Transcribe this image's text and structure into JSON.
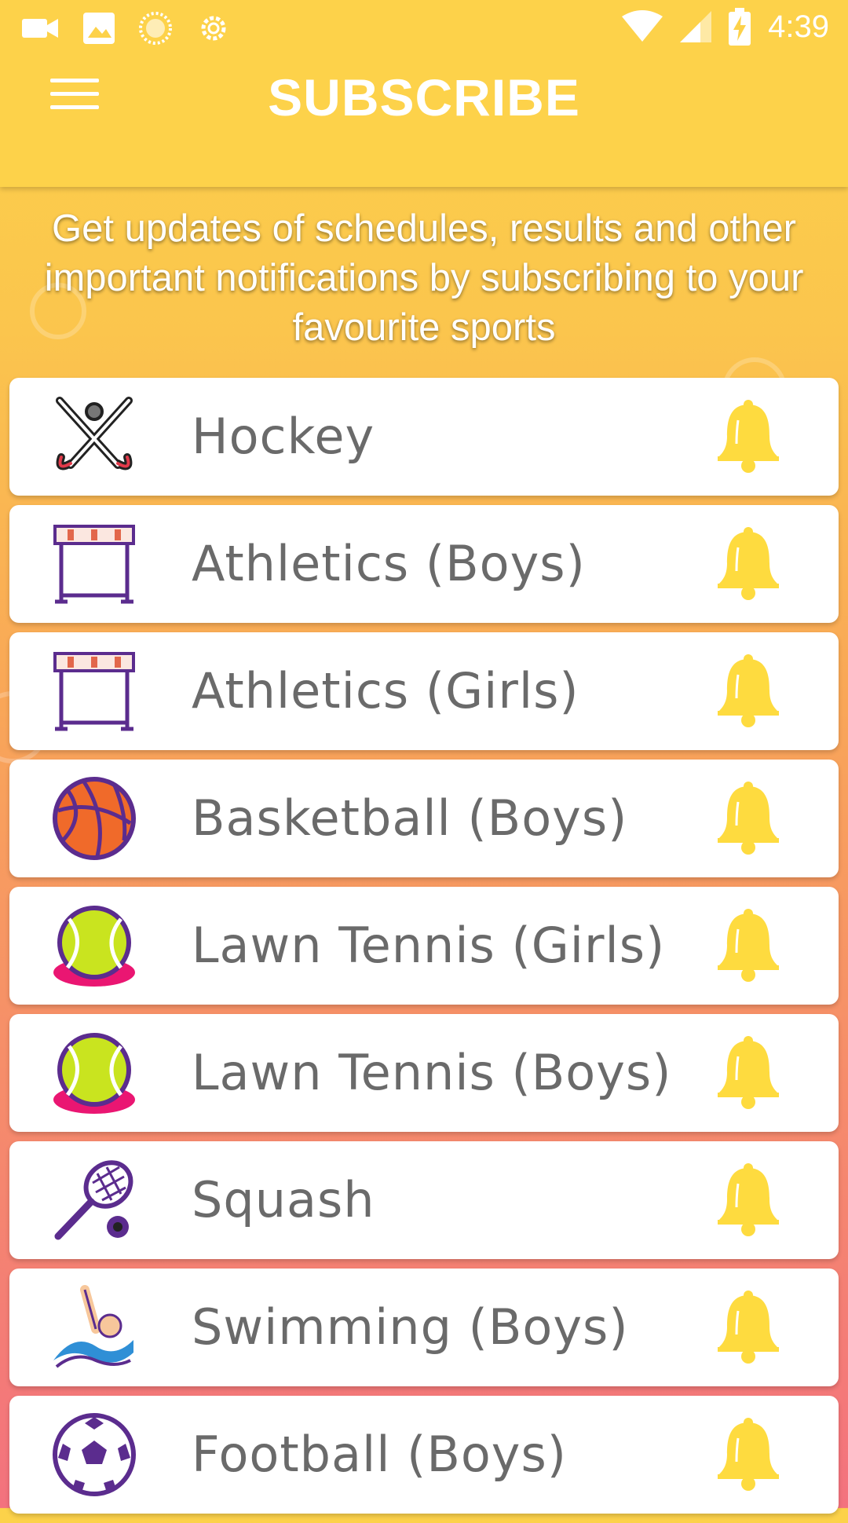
{
  "status_bar": {
    "time": "4:39"
  },
  "app_bar": {
    "title": "SUBSCRIBE"
  },
  "intro_text": "Get updates of schedules, results and other important notifications by subscribing to your favourite sports",
  "colors": {
    "accent": "#FDD24A",
    "bell": "#FEDB3F",
    "label": "#6A6A6A"
  },
  "sports": [
    {
      "label": "Hockey",
      "icon": "hockey-sticks-icon"
    },
    {
      "label": "Athletics (Boys)",
      "icon": "hurdle-icon"
    },
    {
      "label": "Athletics (Girls)",
      "icon": "hurdle-icon"
    },
    {
      "label": "Basketball (Boys)",
      "icon": "basketball-icon"
    },
    {
      "label": "Lawn Tennis (Girls)",
      "icon": "tennis-ball-icon"
    },
    {
      "label": "Lawn Tennis (Boys)",
      "icon": "tennis-ball-icon"
    },
    {
      "label": "Squash",
      "icon": "squash-racket-icon"
    },
    {
      "label": "Swimming (Boys)",
      "icon": "swimmer-icon"
    },
    {
      "label": "Football (Boys)",
      "icon": "football-icon"
    }
  ]
}
